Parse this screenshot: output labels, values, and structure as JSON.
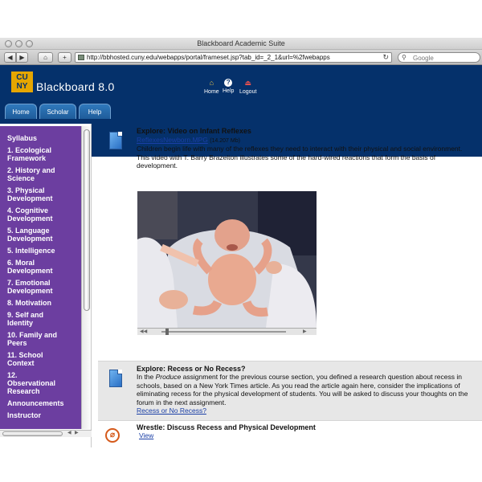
{
  "window": {
    "title": "Blackboard Academic Suite"
  },
  "browser": {
    "url": "http://bbhosted.cuny.edu/webapps/portal/frameset.jsp?tab_id=_2_1&url=%2fwebapps",
    "search_placeholder": "Google",
    "back_icon": "back-arrow",
    "forward_icon": "forward-arrow",
    "home_icon": "house",
    "add_icon": "plus"
  },
  "header": {
    "logo_text_top": "CU",
    "logo_text_bottom": "NY",
    "brand": "Blackboard 8.0",
    "links": [
      {
        "label": "Home",
        "icon": "home-icon"
      },
      {
        "label": "Help",
        "icon": "help-icon"
      },
      {
        "label": "Logout",
        "icon": "logout-icon"
      }
    ],
    "tabs": [
      "Home",
      "Scholar",
      "Help"
    ]
  },
  "sidebar": {
    "items": [
      "Syllabus",
      "1. Ecological Framework",
      "2. History and Science",
      "3. Physical Development",
      "4. Cognitive Development",
      "5. Language Development",
      "5. Intelligence",
      "6. Moral Development",
      "7. Emotional Development",
      "8. Motivation",
      "9. Self and Identity",
      "10. Family and Peers",
      "11. School Context",
      "12. Observational Research",
      "Announcements",
      "Instructor"
    ]
  },
  "content": {
    "video_item": {
      "title": "Explore: Video on Infant Reflexes",
      "file_link": "ReflexesNewborn.MPG",
      "file_size": "(14.207 Mb)",
      "description": "Children begin life with many of the reflexes they need to interact with their physical and social environment. This video with T. Barry Brazelton illustrates some of the hard-wired reactions that form the basis of development."
    },
    "recess_item": {
      "title": "Explore: Recess or No Recess?",
      "desc_pre": "In the ",
      "desc_em": "Produce",
      "desc_post": " assignment for the previous course section, you defined a research question about recess in schools, based on a New York Times article. As you read the article again here, consider the implications of eliminating recess for the physical development of students. You will be asked to discuss your thoughts on the forum in the next assignment.",
      "link": "Recess or No Recess?"
    },
    "wrestle_item": {
      "title": "Wrestle: Discuss Recess and Physical Development",
      "link": "View"
    }
  },
  "colors": {
    "header_bg": "#05316b",
    "sidebar_bg": "#6c3ea0",
    "tab_bg": "#2f79bd",
    "logo_bg": "#e6a600",
    "link": "#1a3fa6"
  }
}
